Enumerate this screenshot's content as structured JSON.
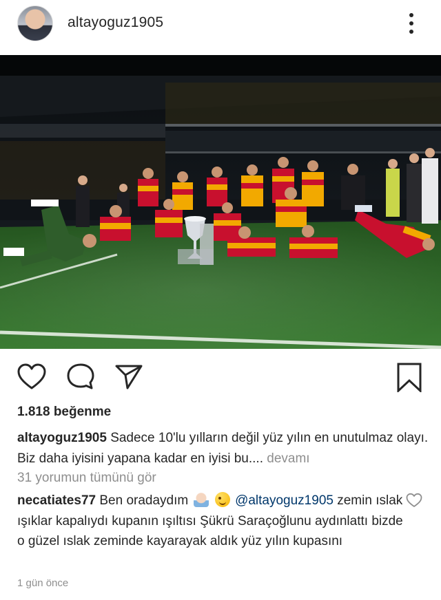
{
  "post": {
    "username": "altayoguz1905",
    "likes_text": "1.818 beğenme",
    "caption_text": "Sadece 10'lu yılların değil yüz yılın en unutulmaz olayı. Biz daha iyisini yapana kadar en iyisi bu....",
    "caption_more": "devamı",
    "view_all_comments": "31 yorumun tümünü gör",
    "timestamp": "1 gün önce"
  },
  "comment": {
    "username": "necatiates77",
    "text_before": "Ben oradaydım",
    "mention": "@altayoguz1905",
    "text_after": "zemin ıslak ışıklar kapalıydı kupanın ışıltısı  Şükrü Saraçoğlunu  aydınlattı bizde o güzel ıslak zeminde kayarayak aldık yüz yılın kupasını",
    "emojis": [
      "man-technologist-emoji",
      "winking-face-emoji"
    ]
  },
  "icons": {
    "more": "vertical-ellipsis-icon",
    "like": "heart-icon",
    "comment": "speech-bubble-icon",
    "share": "paper-plane-icon",
    "save": "bookmark-icon",
    "comment_like": "heart-icon"
  },
  "colors": {
    "text": "#262626",
    "secondary": "#8e8e8e",
    "mention": "#00376b",
    "jersey_red": "#c8102e",
    "jersey_yellow": "#f2a900",
    "pitch": "#2f6b2a"
  }
}
